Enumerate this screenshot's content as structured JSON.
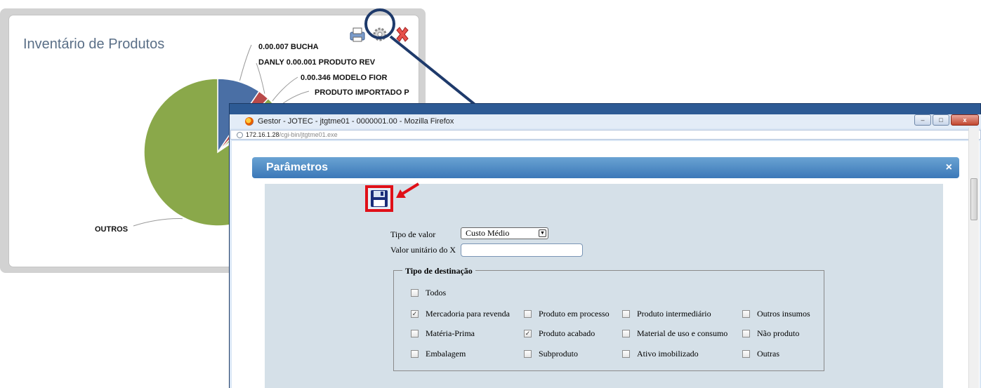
{
  "chart_window": {
    "title": "Inventário de Produtos",
    "toolbar": [
      {
        "name": "print-icon",
        "interactive": true
      },
      {
        "name": "gear-icon",
        "interactive": true
      },
      {
        "name": "close-icon",
        "interactive": true
      }
    ]
  },
  "chart_data": {
    "type": "pie",
    "title": "Inventário de Produtos",
    "slices": [
      {
        "label": "0.00.007 BUCHA",
        "value": 9.5,
        "color": "#4a6fa5"
      },
      {
        "label": "DANLY 0.00.001 PRODUTO REV",
        "value": 2.5,
        "color": "#b84a4a"
      },
      {
        "label": "0.00.346 MODELO FIOR",
        "value": 2.0,
        "color": "#8aa84a"
      },
      {
        "label": "PRODUTO IMPORTADO P",
        "value": 1.5,
        "color": "#7a5ea8"
      },
      {
        "label": "OUTROS",
        "value": 84.5,
        "color": "#8aa84a"
      }
    ]
  },
  "browser": {
    "window_title": "Gestor - JOTEC - jtgtme01 - 0000001.00 - Mozilla Firefox",
    "url_host": "172.16.1.28",
    "url_path": "/cgi-bin/jtgtme01.exe",
    "controls": {
      "minimize": "–",
      "maximize": "□",
      "close": "x"
    }
  },
  "dialog": {
    "title": "Parâmetros",
    "close": "×",
    "tipo_valor_label": "Tipo de valor",
    "tipo_valor_selected": "Custo Médio",
    "valor_unitario_label": "Valor unitário do X",
    "valor_unitario_value": "",
    "destinacao_legend": "Tipo de destinação",
    "checkboxes": [
      {
        "label": "Todos",
        "checked": false
      },
      {
        "label": "Mercadoria para revenda",
        "checked": true
      },
      {
        "label": "Produto em processo",
        "checked": false
      },
      {
        "label": "Produto intermediário",
        "checked": false
      },
      {
        "label": "Outros insumos",
        "checked": false
      },
      {
        "label": "Matéria-Prima",
        "checked": false
      },
      {
        "label": "Produto acabado",
        "checked": true
      },
      {
        "label": "Material de uso e consumo",
        "checked": false
      },
      {
        "label": "Não produto",
        "checked": false
      },
      {
        "label": "Embalagem",
        "checked": false
      },
      {
        "label": "Subproduto",
        "checked": false
      },
      {
        "label": "Ativo imobilizado",
        "checked": false
      },
      {
        "label": "Outras",
        "checked": false
      }
    ]
  },
  "colors": {
    "dialog_header": "#3b78b8",
    "highlight": "#e01018",
    "zoom_ring": "#1e3a6b"
  }
}
